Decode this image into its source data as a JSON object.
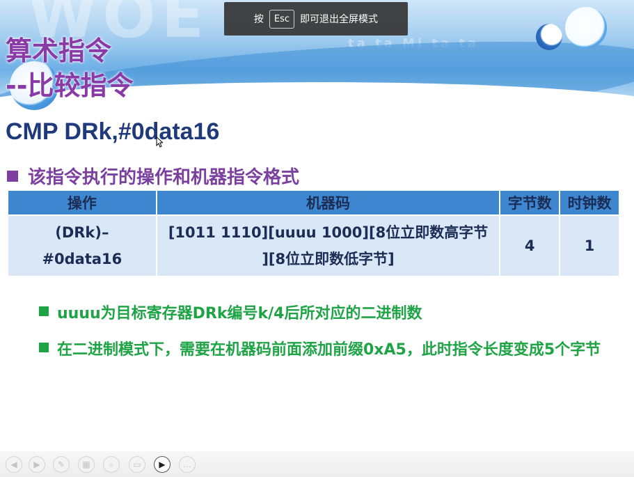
{
  "fullscreen_notice": {
    "prefix": "按",
    "key": "Esc",
    "suffix": "即可退出全屏模式"
  },
  "slide": {
    "title_line1": "算术指令",
    "title_line2": "--比较指令",
    "instruction": "CMP DRk,#0data16",
    "section_heading": "该指令执行的操作和机器指令格式",
    "table": {
      "headers": [
        "操作",
        "机器码",
        "字节数",
        "时钟数"
      ],
      "row": {
        "operation": "(DRk)–#0data16",
        "machine_code_line1": "[1011 1110][uuuu 1000][8位立即数高字节",
        "machine_code_line2": "][8位立即数低字节]",
        "bytes": "4",
        "clocks": "1"
      }
    },
    "bullets": [
      "uuuu为目标寄存器DRk编号k/4后所对应的二进制数",
      "在二进制模式下，需要在机器码前面添加前缀0xA5，此时指令长度变成5个字节"
    ]
  },
  "banner_watermark": {
    "left": "WOE",
    "right": "ta ta Mi ta ta"
  },
  "player_controls": [
    {
      "name": "prev-icon",
      "glyph": "◀"
    },
    {
      "name": "next-icon",
      "glyph": "▶"
    },
    {
      "name": "pen-icon",
      "glyph": "✎"
    },
    {
      "name": "slides-icon",
      "glyph": "▦"
    },
    {
      "name": "zoom-icon",
      "glyph": "⌕"
    },
    {
      "name": "screen-icon",
      "glyph": "▭"
    },
    {
      "name": "camera-icon",
      "glyph": "▶"
    },
    {
      "name": "more-icon",
      "glyph": "…"
    }
  ],
  "colors": {
    "title": "#8a3aa6",
    "heading": "#7b3fa0",
    "table_header": "#3f86d0",
    "table_body": "#d9e7f6",
    "bullet": "#1ea345",
    "command": "#1f3a7a"
  }
}
